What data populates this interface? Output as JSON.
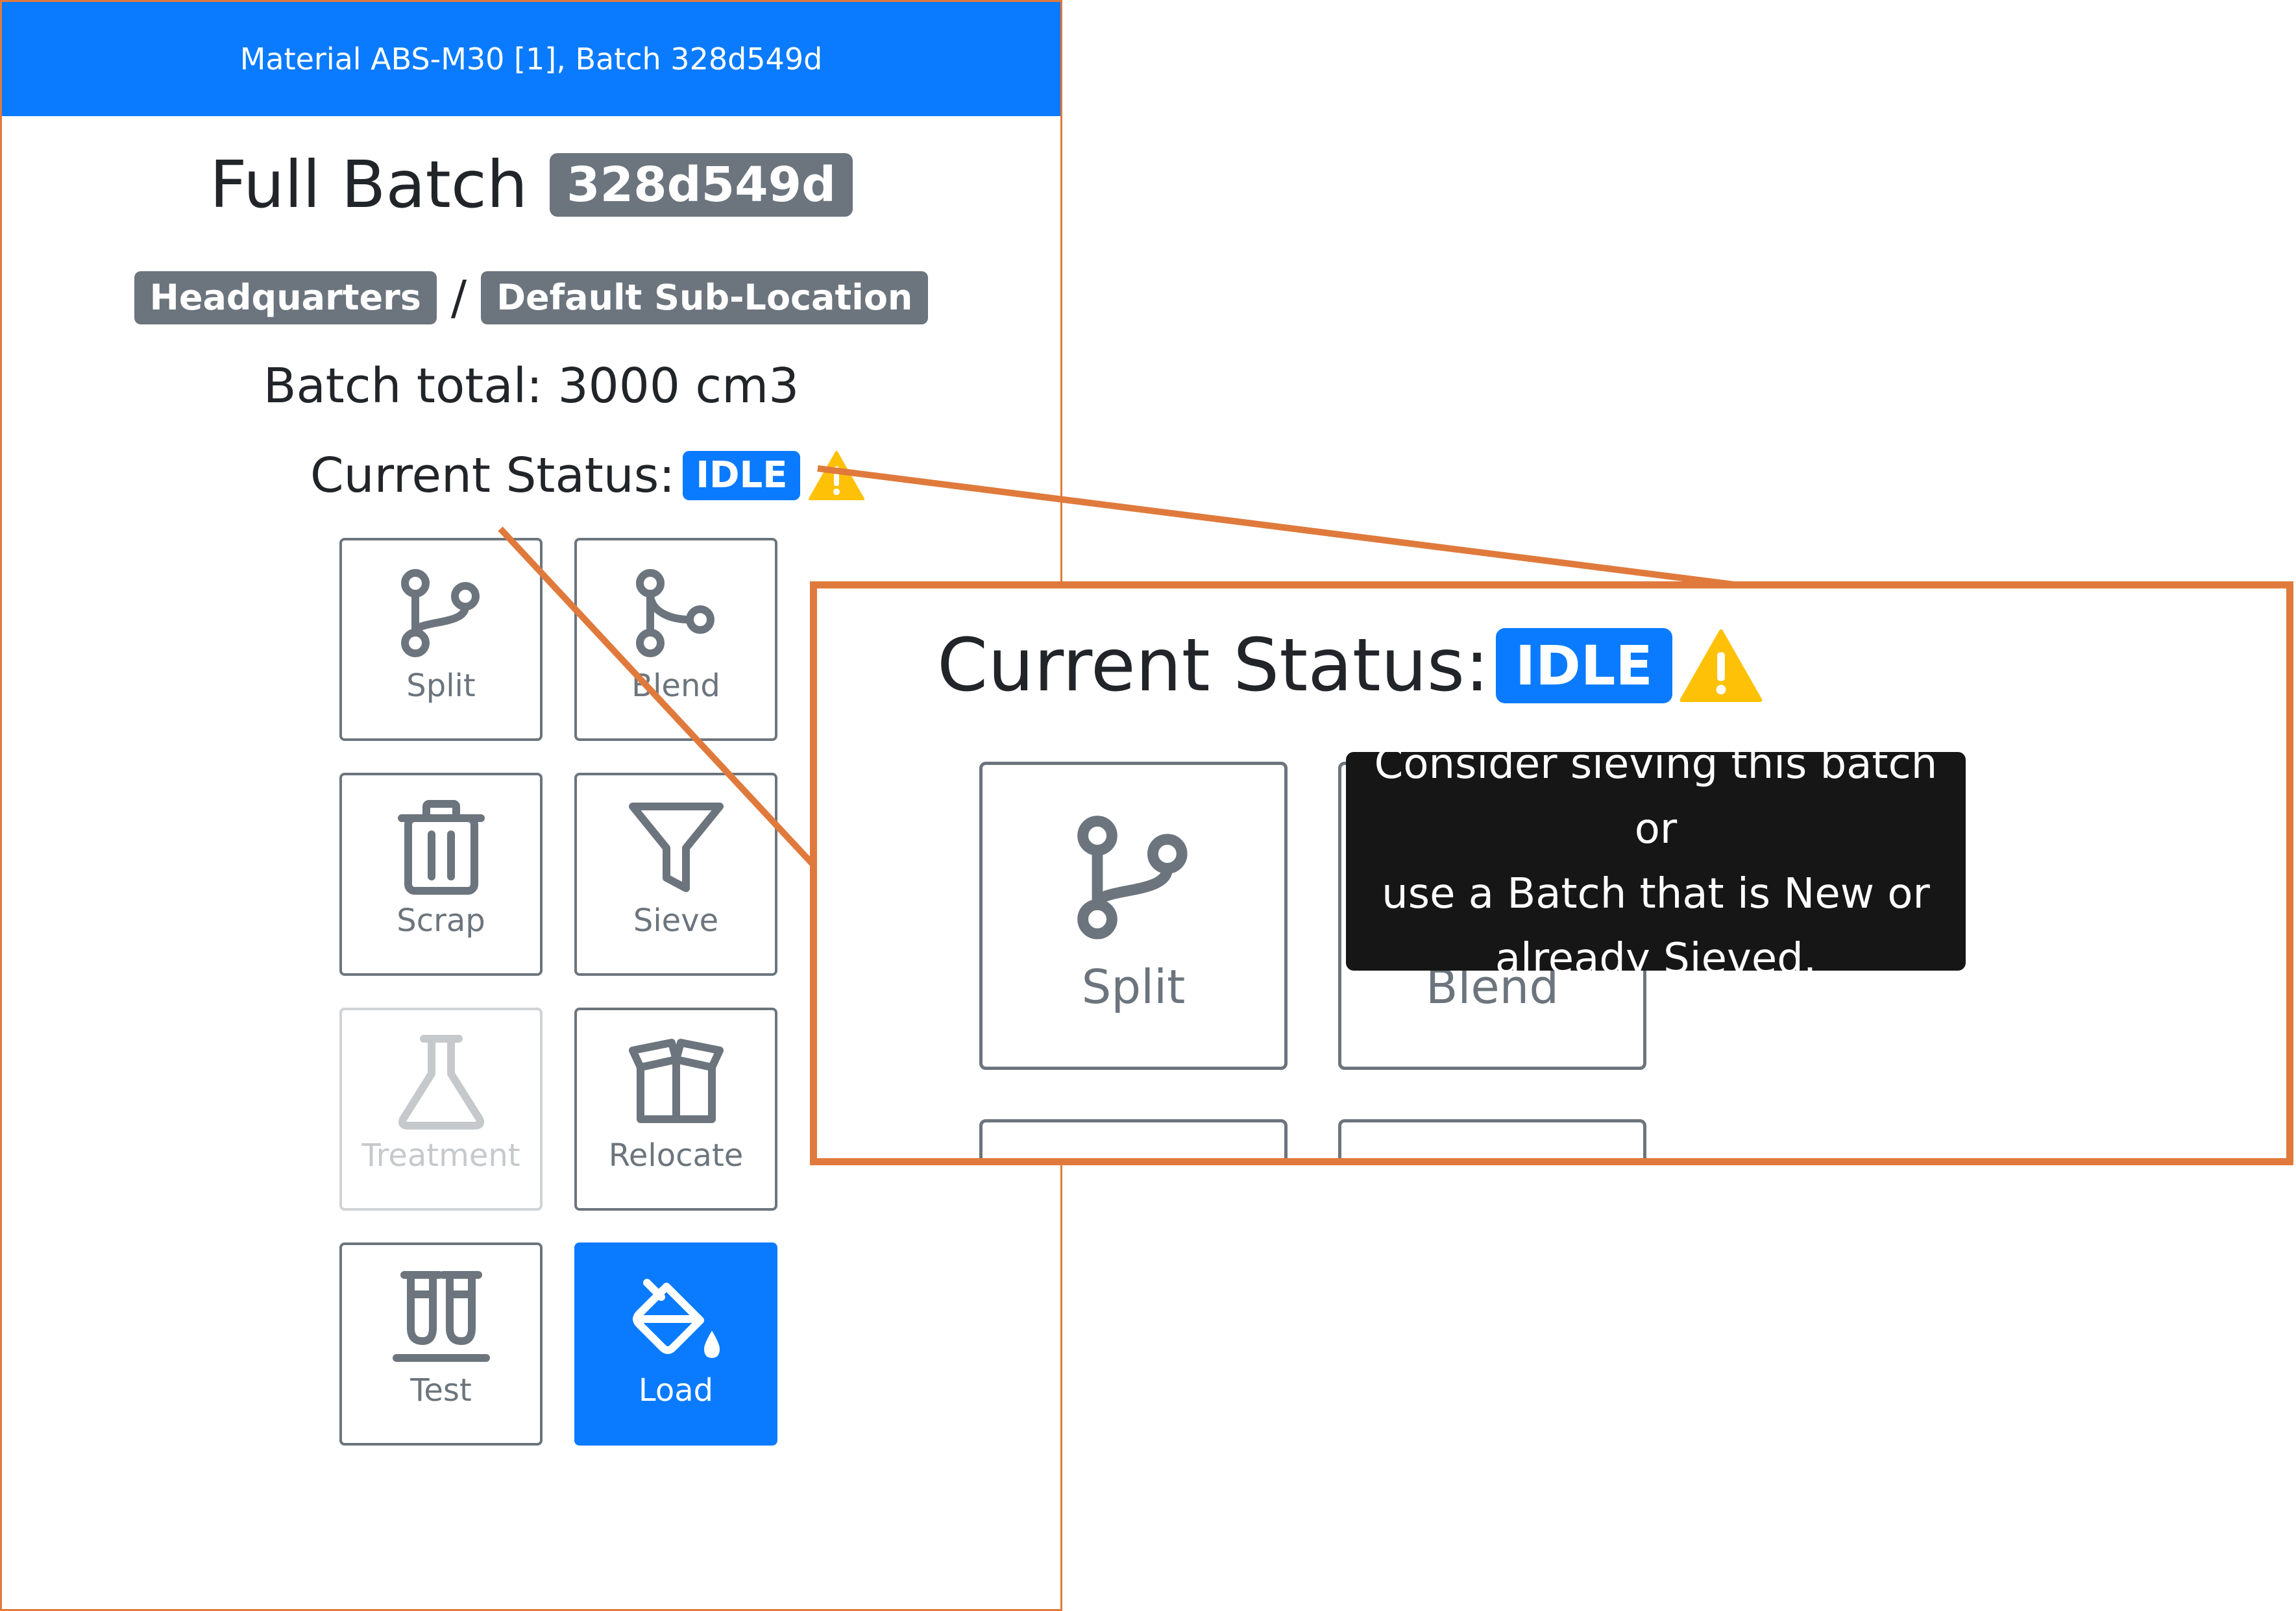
{
  "header": {
    "title": "Material ABS-M30 [1], Batch 328d549d"
  },
  "batch": {
    "heading": "Full Batch",
    "id": "328d549d",
    "location": "Headquarters",
    "separator": "/",
    "sub_location": "Default Sub-Location",
    "total": "Batch total: 3000 cm3"
  },
  "status": {
    "label": "Current Status:",
    "value": "IDLE",
    "warning_icon": "warning-triangle-icon"
  },
  "actions": [
    {
      "label": "Split",
      "icon": "git-branch-icon",
      "state": "enabled"
    },
    {
      "label": "Blend",
      "icon": "git-merge-icon",
      "state": "enabled"
    },
    {
      "label": "Scrap",
      "icon": "trash-icon",
      "state": "enabled"
    },
    {
      "label": "Sieve",
      "icon": "funnel-icon",
      "state": "enabled"
    },
    {
      "label": "Treatment",
      "icon": "flask-icon",
      "state": "disabled"
    },
    {
      "label": "Relocate",
      "icon": "box-icon",
      "state": "enabled"
    },
    {
      "label": "Test",
      "icon": "test-tubes-icon",
      "state": "enabled"
    },
    {
      "label": "Load",
      "icon": "paint-bucket-icon",
      "state": "primary"
    }
  ],
  "tooltip": {
    "lines": [
      "Consider sieving this batch or",
      "use a Batch that is New or",
      "already Sieved."
    ]
  },
  "colors": {
    "primary": "#0a7bff",
    "secondary": "#6c757d",
    "warning": "#ffc107",
    "callout": "#e07a3c"
  }
}
